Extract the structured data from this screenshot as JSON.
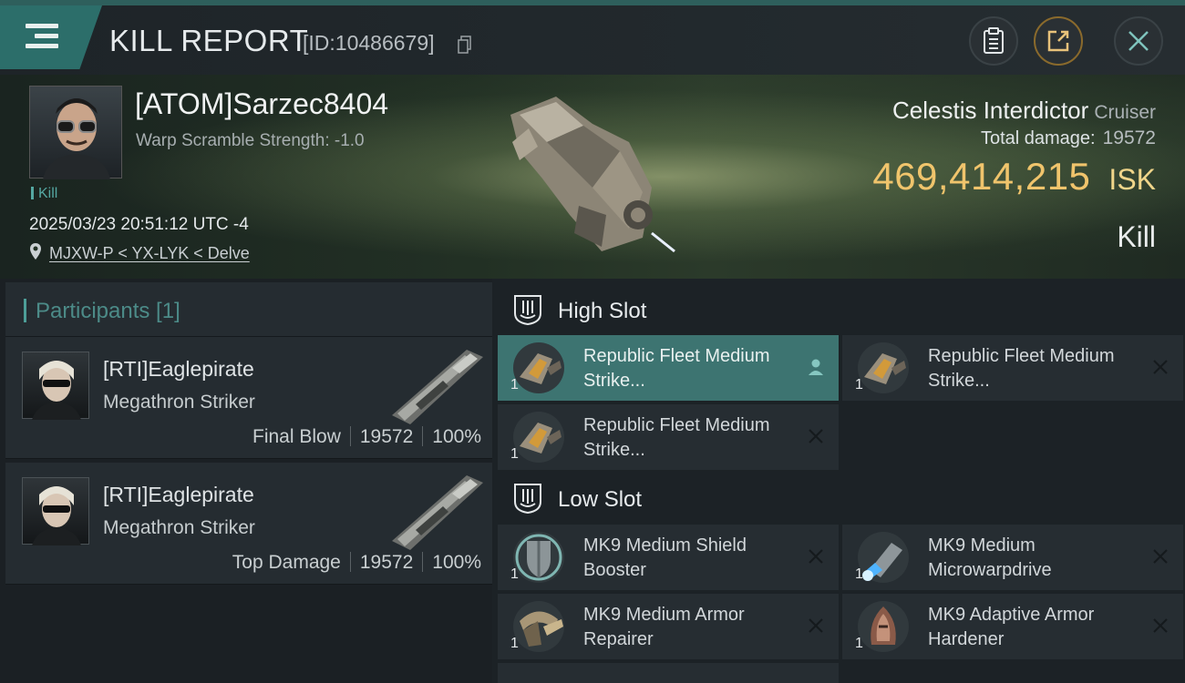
{
  "header": {
    "title": "KILL REPORT",
    "kill_id": "[ID:10486679]"
  },
  "victim": {
    "name": "[ATOM]Sarzec8404",
    "warp_scramble": "Warp Scramble Strength: -1.0",
    "tag": "Kill",
    "datetime": "2025/03/23 20:51:12 UTC -4",
    "location": "MJXW-P < YX-LYK < Delve",
    "ship_name": "Celestis Interdictor",
    "ship_class": "Cruiser",
    "total_damage_label": "Total damage:",
    "total_damage": "19572",
    "isk_value": "469,414,215",
    "isk_unit": "ISK",
    "report_type": "Kill"
  },
  "participants": {
    "title": "Participants [1]",
    "list": [
      {
        "name": "[RTI]Eaglepirate",
        "ship": "Megathron Striker",
        "role": "Final Blow",
        "damage": "19572",
        "percent": "100%"
      },
      {
        "name": "[RTI]Eaglepirate",
        "ship": "Megathron Striker",
        "role": "Top Damage",
        "damage": "19572",
        "percent": "100%"
      }
    ]
  },
  "fitting": {
    "high_slot_title": "High Slot",
    "low_slot_title": "Low Slot",
    "high_items": [
      {
        "name": "Republic Fleet Medium Strike...",
        "qty": "1",
        "action_icon": "person-icon"
      },
      {
        "name": "Republic Fleet Medium Strike...",
        "qty": "1",
        "action_icon": "close-icon"
      },
      {
        "name": "Republic Fleet Medium Strike...",
        "qty": "1",
        "action_icon": "close-icon"
      }
    ],
    "low_items": [
      {
        "name": "MK9 Medium Shield Booster",
        "qty": "1",
        "action_icon": "close-icon"
      },
      {
        "name": "MK9 Medium Microwarpdrive",
        "qty": "1",
        "action_icon": "close-icon"
      },
      {
        "name": "MK9 Medium Armor Repairer",
        "qty": "1",
        "action_icon": "close-icon"
      },
      {
        "name": "MK9 Adaptive Armor Hardener",
        "qty": "1",
        "action_icon": "close-icon"
      }
    ]
  },
  "colors": {
    "accent_teal": "#2c6e6a",
    "isk_gold": "#f0c46c",
    "active_item": "#3d7471"
  }
}
